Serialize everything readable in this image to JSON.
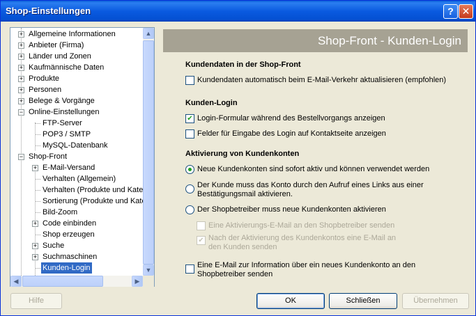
{
  "window": {
    "title": "Shop-Einstellungen",
    "help_glyph": "?",
    "close_glyph": "✕"
  },
  "tree": {
    "items": [
      {
        "label": "Allgemeine Informationen",
        "level": 0,
        "expander": "+"
      },
      {
        "label": "Anbieter (Firma)",
        "level": 0,
        "expander": "+"
      },
      {
        "label": "Länder und Zonen",
        "level": 0,
        "expander": "+"
      },
      {
        "label": "Kaufmännische Daten",
        "level": 0,
        "expander": "+"
      },
      {
        "label": "Produkte",
        "level": 0,
        "expander": "+"
      },
      {
        "label": "Personen",
        "level": 0,
        "expander": "+"
      },
      {
        "label": "Belege & Vorgänge",
        "level": 0,
        "expander": "+"
      },
      {
        "label": "Online-Einstellungen",
        "level": 0,
        "expander": "−"
      },
      {
        "label": "FTP-Server",
        "level": 1,
        "expander": ""
      },
      {
        "label": "POP3 / SMTP",
        "level": 1,
        "expander": ""
      },
      {
        "label": "MySQL-Datenbank",
        "level": 1,
        "expander": ""
      },
      {
        "label": "Shop-Front",
        "level": 0,
        "expander": "−"
      },
      {
        "label": "E-Mail-Versand",
        "level": 1,
        "expander": "+"
      },
      {
        "label": "Verhalten (Allgemein)",
        "level": 1,
        "expander": ""
      },
      {
        "label": "Verhalten (Produkte und Kateg",
        "level": 1,
        "expander": ""
      },
      {
        "label": "Sortierung (Produkte und Kateg",
        "level": 1,
        "expander": ""
      },
      {
        "label": "Bild-Zoom",
        "level": 1,
        "expander": ""
      },
      {
        "label": "Code einbinden",
        "level": 1,
        "expander": "+"
      },
      {
        "label": "Shop erzeugen",
        "level": 1,
        "expander": ""
      },
      {
        "label": "Suche",
        "level": 1,
        "expander": "+"
      },
      {
        "label": "Suchmaschinen",
        "level": 1,
        "expander": "+"
      },
      {
        "label": "Kunden-Login",
        "level": 1,
        "expander": "",
        "selected": true
      }
    ],
    "scroll_up": "▲",
    "scroll_down": "▼",
    "scroll_left": "◀",
    "scroll_right": "▶"
  },
  "panel": {
    "banner": "Shop-Front - Kunden-Login",
    "sections": {
      "kundendaten": "Kundendaten in der Shop-Front",
      "login": "Kunden-Login",
      "aktivierung": "Aktivierung von Kundenkonten"
    },
    "options": {
      "auto_update": {
        "label": "Kundendaten automatisch beim E-Mail-Verkehr aktualisieren (empfohlen)",
        "checked": false
      },
      "login_form": {
        "label": "Login-Formular während des Bestellvorgangs anzeigen",
        "checked": true
      },
      "contact_login": {
        "label": "Felder für Eingabe des Login auf Kontaktseite anzeigen",
        "checked": false
      },
      "radio_immediate": {
        "label": "Neue Kundenkonten sind sofort aktiv und können verwendet werden",
        "selected": true
      },
      "radio_link": {
        "label": "Der Kunde muss das Konto durch den Aufruf eines Links aus einer Bestätigungsmail aktivieren.",
        "selected": false
      },
      "radio_operator": {
        "label": "Der Shopbetreiber muss neue Kundenkonten  aktivieren",
        "selected": false
      },
      "send_activation_mail": {
        "label": "Eine Aktivierungs-E-Mail an den Shopbetreiber senden",
        "checked": false,
        "enabled": false
      },
      "notify_customer": {
        "label": "Nach der Aktivierung des Kundenkontos eine E-Mail an den Kunden senden",
        "checked": true,
        "enabled": false
      },
      "info_mail": {
        "label": "Eine E-Mail zur Information über ein neues Kundenkonto an den Shopbetreiber senden",
        "checked": false
      }
    },
    "check_glyph": "✔"
  },
  "buttons": {
    "help": "Hilfe",
    "ok": "OK",
    "close": "Schließen",
    "apply": "Übernehmen"
  }
}
